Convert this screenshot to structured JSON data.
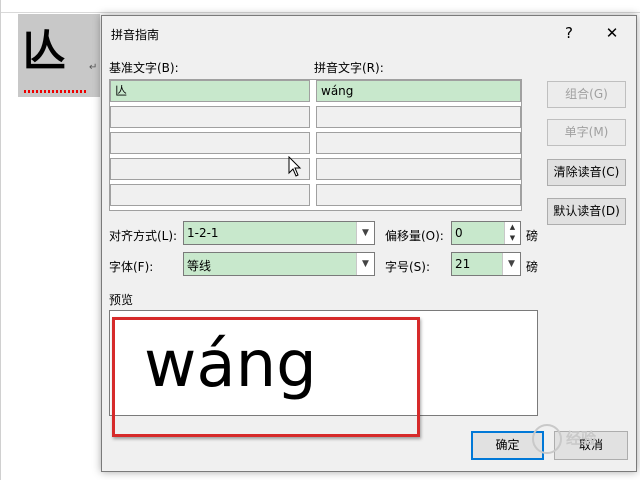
{
  "document": {
    "character": "亾",
    "paragraph_mark": "↵"
  },
  "dialog": {
    "title": "拼音指南",
    "help_label": "?",
    "close_label": "✕",
    "base_text_label": "基准文字(B):",
    "ruby_text_label": "拼音文字(R):",
    "rows": [
      {
        "base": "亾",
        "ruby": "wáng"
      },
      {
        "base": "",
        "ruby": ""
      },
      {
        "base": "",
        "ruby": ""
      },
      {
        "base": "",
        "ruby": ""
      },
      {
        "base": "",
        "ruby": ""
      }
    ],
    "side_buttons": {
      "group": "组合(G)",
      "single": "单字(M)",
      "clear": "清除读音(C)",
      "default_reading": "默认读音(D)"
    },
    "alignment_label": "对齐方式(L):",
    "alignment_value": "1-2-1",
    "offset_label": "偏移量(O):",
    "offset_value": "0",
    "offset_unit": "磅",
    "font_label": "字体(F):",
    "font_value": "等线",
    "size_label": "字号(S):",
    "size_value": "21",
    "size_unit": "磅",
    "preview_label": "预览",
    "preview_text": "wáng",
    "ok_label": "确定",
    "cancel_label": "取消"
  },
  "watermark": {
    "text": "经验"
  },
  "colors": {
    "highlight_border": "#d62a2a",
    "field_green": "#c8e8cc",
    "default_button_border": "#0078d7"
  },
  "icons": {
    "cursor": "mouse-pointer-icon",
    "dropdown": "chevron-down-icon"
  }
}
